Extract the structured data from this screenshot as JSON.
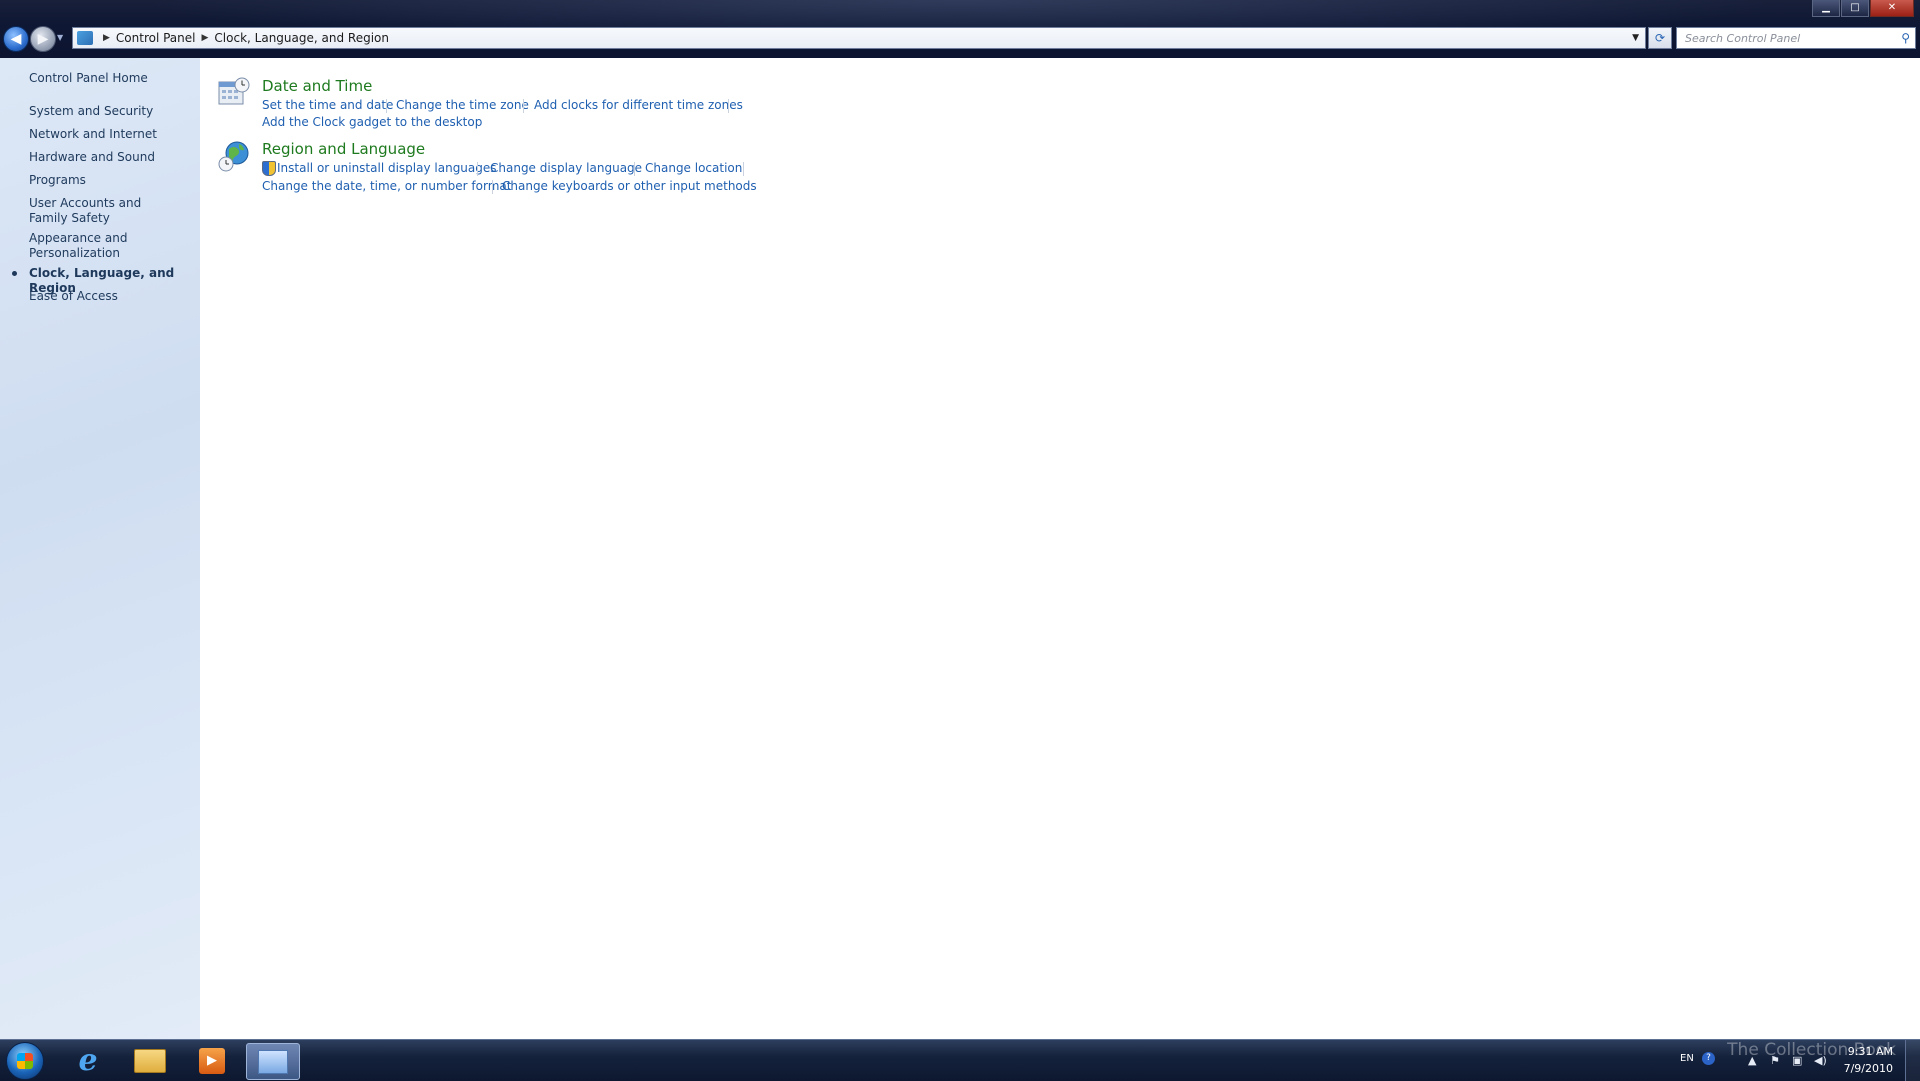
{
  "window": {
    "minimize_glyph": "▁",
    "maximize_glyph": "□",
    "close_glyph": "✕"
  },
  "address": {
    "crumbs": [
      "Control Panel",
      "Clock, Language, and Region"
    ],
    "search_placeholder": "Search Control Panel"
  },
  "sidebar": {
    "items": [
      {
        "label": "Control Panel Home"
      },
      {
        "label": "System and Security"
      },
      {
        "label": "Network and Internet"
      },
      {
        "label": "Hardware and Sound"
      },
      {
        "label": "Programs"
      },
      {
        "label": "User Accounts and Family Safety"
      },
      {
        "label": "Appearance and Personalization"
      },
      {
        "label": "Clock, Language, and Region"
      },
      {
        "label": "Ease of Access"
      }
    ]
  },
  "main": {
    "categories": [
      {
        "title": "Date and Time",
        "links": [
          "Set the time and date",
          "Change the time zone",
          "Add clocks for different time zones",
          "Add the Clock gadget to the desktop"
        ]
      },
      {
        "title": "Region and Language",
        "links": [
          "Install or uninstall display languages",
          "Change display language",
          "Change location",
          "Change the date, time, or number format",
          "Change keyboards or other input methods"
        ]
      }
    ]
  },
  "taskbar": {
    "language": "EN",
    "time": "9:31 AM",
    "date": "7/9/2010",
    "watermark": "The Collection Book"
  },
  "colors": {
    "link": "#1f5fb0",
    "category_title": "#1e7a1e",
    "sidebar_text": "#1e395b"
  }
}
